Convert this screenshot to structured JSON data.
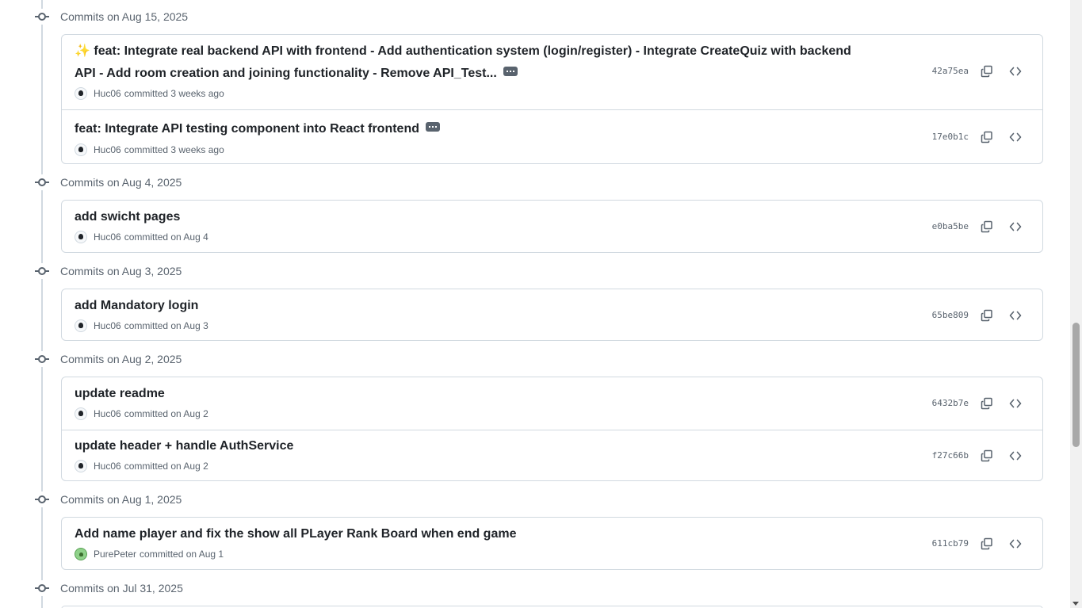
{
  "groups": [
    {
      "date": "Commits on Aug 15, 2025",
      "commits": [
        {
          "emoji": "✨",
          "message": "feat: Integrate real backend API with frontend - Add authentication system (login/register) - Integrate CreateQuiz with backend API - Add room creation and joining functionality - Remove API_Test...",
          "author": "Huc06",
          "time": "committed 3 weeks ago",
          "sha": "42a75ea"
        },
        {
          "message": "feat: Integrate API testing component into React frontend",
          "author": "Huc06",
          "time": "committed 3 weeks ago",
          "sha": "17e0b1c"
        }
      ]
    },
    {
      "date": "Commits on Aug 4, 2025",
      "commits": [
        {
          "message": "add swicht pages",
          "author": "Huc06",
          "time": "committed on Aug 4",
          "sha": "e0ba5be"
        }
      ]
    },
    {
      "date": "Commits on Aug 3, 2025",
      "commits": [
        {
          "message": "add Mandatory login",
          "author": "Huc06",
          "time": "committed on Aug 3",
          "sha": "65be809"
        }
      ]
    },
    {
      "date": "Commits on Aug 2, 2025",
      "commits": [
        {
          "message": "update readme",
          "author": "Huc06",
          "time": "committed on Aug 2",
          "sha": "6432b7e"
        },
        {
          "message": "update header + handle AuthService",
          "author": "Huc06",
          "time": "committed on Aug 2",
          "sha": "f27c66b"
        }
      ]
    },
    {
      "date": "Commits on Aug 1, 2025",
      "commits": [
        {
          "message": "Add name player and fix the show all PLayer Rank Board when end game",
          "author": "PurePeter",
          "time": "committed on Aug 1",
          "sha": "611cb79"
        }
      ]
    },
    {
      "date": "Commits on Jul 31, 2025",
      "commits": []
    }
  ],
  "icons": {
    "commit_node": "git-commit-icon",
    "copy": "copy-icon",
    "browse": "code-icon",
    "more": "ellipsis-icon"
  },
  "colors": {
    "text": "#1f2328",
    "muted": "#59636e",
    "border": "#d1d9e0"
  }
}
